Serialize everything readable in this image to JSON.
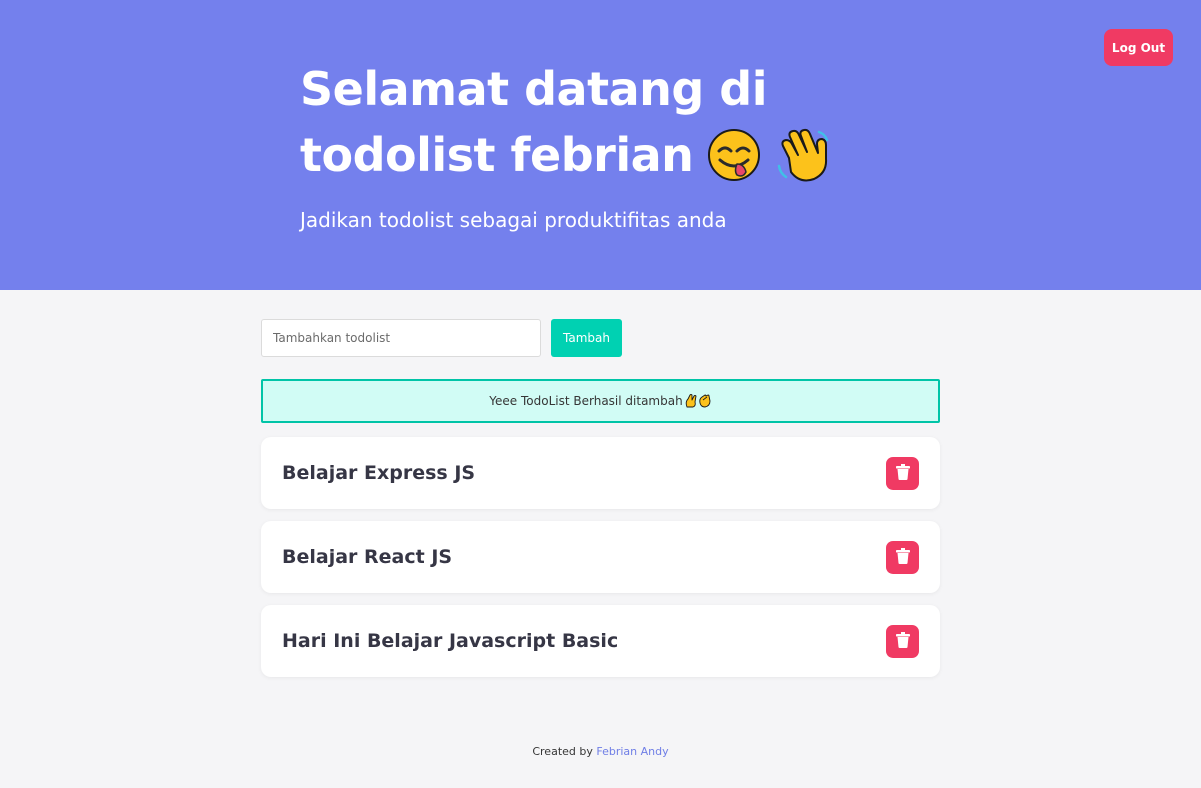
{
  "header": {
    "logout_label": "Log Out",
    "title": "Selamat datang di todolist febrian",
    "title_emojis": [
      "face-savoring-food-emoji",
      "waving-hand-emoji"
    ],
    "subtitle": "Jadikan todolist sebagai produktifitas anda"
  },
  "form": {
    "placeholder": "Tambahkan todolist",
    "value": "",
    "submit_label": "Tambah"
  },
  "notification": {
    "message": "Yeee TodoList Berhasil ditambah",
    "emojis": [
      "crossed-fingers-emoji",
      "clapping-hands-emoji"
    ]
  },
  "todos": [
    {
      "title": "Belajar Express JS",
      "delete_icon": "trash-icon"
    },
    {
      "title": "Belajar React JS",
      "delete_icon": "trash-icon"
    },
    {
      "title": "Hari Ini Belajar Javascript Basic",
      "delete_icon": "trash-icon"
    }
  ],
  "footer": {
    "prefix": "Created by",
    "author": "Febrian Andy"
  },
  "colors": {
    "hero_background": "#7480ed",
    "page_background": "#f5f5f7",
    "danger": "#f03a63",
    "primary": "#00d1b2",
    "notification_background": "#d1fcf5",
    "notification_border": "#00c4a7",
    "link": "#6f7ee6"
  }
}
